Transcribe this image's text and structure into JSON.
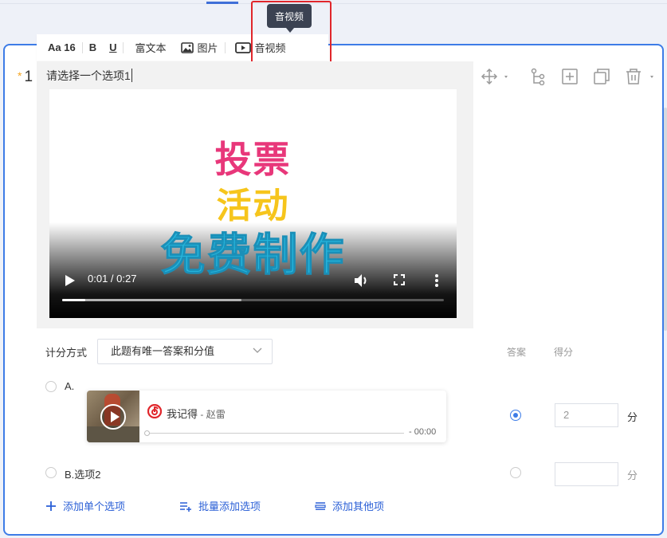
{
  "tooltip": {
    "text": "音视频"
  },
  "toolbar": {
    "font_size": "Aa 16",
    "bold": "B",
    "underline": "U",
    "rich_text": "富文本",
    "image": "图片",
    "media": "音视频"
  },
  "question": {
    "number": "1",
    "required_mark": "*",
    "text": "请选择一个选项1"
  },
  "video": {
    "overlay_line1": "投票",
    "overlay_line2": "活动",
    "overlay_line3": "免费制作",
    "time_display": "0:01 / 0:27",
    "played_fraction": 0.06,
    "buffered_fraction": 0.47
  },
  "scoring": {
    "label": "计分方式",
    "selected": "此题有唯一答案和分值",
    "col_answer": "答案",
    "col_score": "得分"
  },
  "options": [
    {
      "label": "A.",
      "answer_checked": true,
      "score": "2",
      "unit": "分",
      "music": {
        "title": "我记得",
        "artist": "赵雷",
        "time": "- 00:00",
        "progress_fraction": 0.0
      }
    },
    {
      "label": "B.选项2",
      "answer_checked": false,
      "score": "",
      "unit": "分"
    }
  ],
  "actions": {
    "add_single": "添加单个选项",
    "add_batch": "批量添加选项",
    "add_other": "添加其他项"
  },
  "colors": {
    "accent": "#3d7ce7",
    "highlight": "#e0262b",
    "link": "#2a5fd6",
    "star": "#f5a623"
  },
  "icons": [
    "video-icon",
    "image-icon",
    "move-icon",
    "logic-icon",
    "add-box-icon",
    "copy-icon",
    "trash-icon",
    "chevron-down-icon",
    "netease-music-icon",
    "plus-icon",
    "batch-add-icon",
    "other-add-icon"
  ]
}
